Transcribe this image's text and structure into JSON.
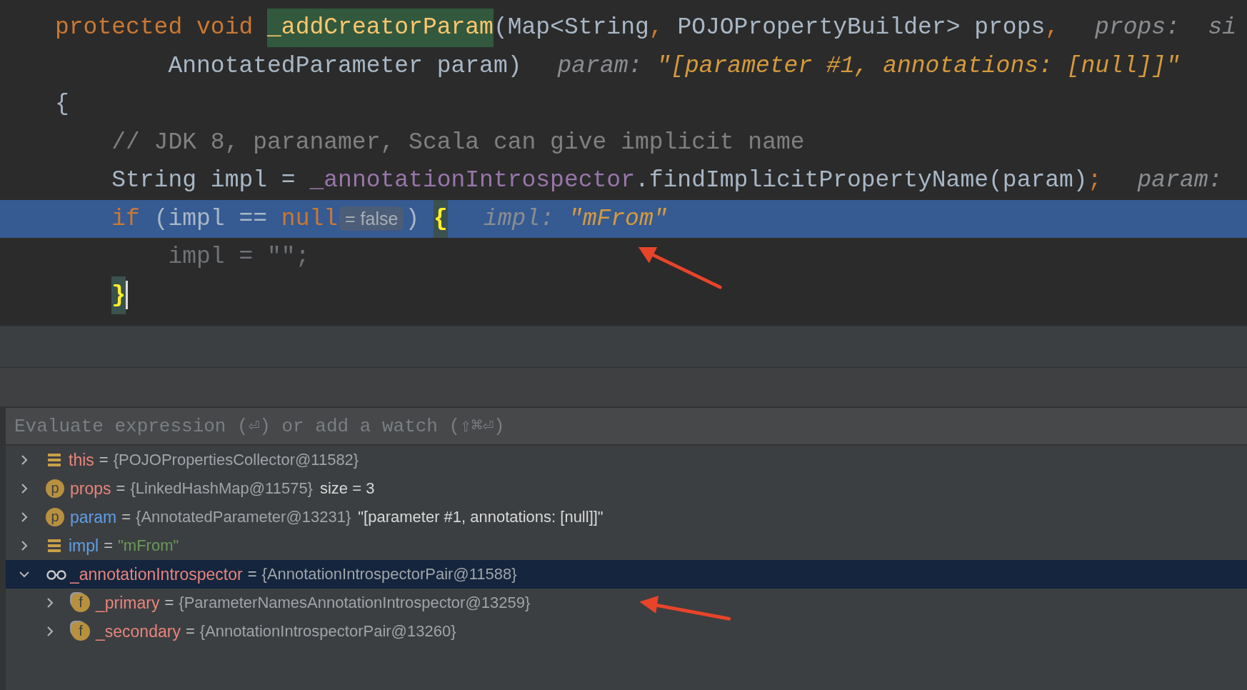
{
  "code": {
    "lines": [
      {
        "execution_point": false,
        "caret": false,
        "tokens": [
          {
            "kind": "keyword",
            "text": "protected void "
          },
          {
            "kind": "method-declaration",
            "text": "_addCreatorParam"
          },
          {
            "kind": "plain",
            "text": "(Map<String"
          },
          {
            "kind": "keyword",
            "text": ", "
          },
          {
            "kind": "plain",
            "text": "POJOPropertyBuilder> props"
          },
          {
            "kind": "keyword",
            "text": ","
          }
        ],
        "hint": {
          "label": "props:  si"
        }
      },
      {
        "execution_point": false,
        "caret": false,
        "tokens": [
          {
            "kind": "plain",
            "text": "        AnnotatedParameter param)"
          }
        ],
        "hint": {
          "label": "param:",
          "value": "\"[parameter #1, annotations: [null]]\""
        }
      },
      {
        "execution_point": false,
        "caret": false,
        "tokens": [
          {
            "kind": "plain",
            "text": "{"
          }
        ]
      },
      {
        "execution_point": false,
        "caret": false,
        "tokens": [
          {
            "kind": "comment",
            "text": "    // JDK 8, paranamer, Scala can give implicit name"
          }
        ]
      },
      {
        "execution_point": false,
        "caret": false,
        "tokens": [
          {
            "kind": "plain",
            "text": "    String impl = "
          },
          {
            "kind": "field",
            "text": "_annotationIntrospector"
          },
          {
            "kind": "plain",
            "text": ".findImplicitPropertyName(param)"
          },
          {
            "kind": "keyword",
            "text": ";"
          }
        ],
        "hint": {
          "label": "param:"
        }
      },
      {
        "execution_point": true,
        "caret": false,
        "tokens": [
          {
            "kind": "keyword",
            "text": "    if "
          },
          {
            "kind": "plain",
            "text": "(impl == "
          },
          {
            "kind": "keyword",
            "text": "null"
          },
          {
            "kind": "inline-value",
            "text": "= false"
          },
          {
            "kind": "plain",
            "text": ") "
          },
          {
            "kind": "brace-match",
            "text": "{"
          }
        ],
        "hint": {
          "label": "impl:",
          "value": "\"mFrom\""
        }
      },
      {
        "execution_point": false,
        "caret": false,
        "tokens": [
          {
            "kind": "dimmed",
            "text": "        impl = \"\";"
          }
        ]
      },
      {
        "execution_point": false,
        "caret": true,
        "indented": true,
        "tokens": [
          {
            "kind": "brace-match",
            "text": "}"
          }
        ]
      }
    ]
  },
  "debugger": {
    "evaluate": {
      "placeholder": "Evaluate expression (⏎) or add a watch (⇧⌘⏎)"
    },
    "variables": [
      {
        "kind": "local",
        "name": "this",
        "color": "#e8847d",
        "operator": "=",
        "value": "{POJOPropertiesCollector@11582}",
        "expanded": false,
        "selected": false
      },
      {
        "kind": "parameter",
        "icon_text": "p",
        "name": "props",
        "color": "#e8847d",
        "operator": "=",
        "value": "{LinkedHashMap@11575}",
        "extra": "size = 3",
        "expanded": false,
        "selected": false
      },
      {
        "kind": "parameter",
        "icon_text": "p",
        "name": "param",
        "color": "#5f9ee8",
        "operator": "=",
        "value": "{AnnotatedParameter@13231}",
        "extra": "\"[parameter #1, annotations: [null]]\"",
        "expanded": false,
        "selected": false
      },
      {
        "kind": "string-local",
        "name": "impl",
        "color": "#5f9ee8",
        "operator": "=",
        "value": "\"mFrom\"",
        "expanded": false,
        "selected": false
      },
      {
        "kind": "watch",
        "name": "_annotationIntrospector",
        "color": "#e8847d",
        "operator": "=",
        "value": "{AnnotationIntrospectorPair@11588}",
        "expanded": true,
        "selected": true,
        "children": [
          {
            "kind": "field",
            "icon_text": "f",
            "name": "_primary",
            "color": "#e8847d",
            "operator": "=",
            "value": "{ParameterNamesAnnotationIntrospector@13259}",
            "expanded": false,
            "selected": false
          },
          {
            "kind": "field",
            "icon_text": "f",
            "name": "_secondary",
            "color": "#e8847d",
            "operator": "=",
            "value": "{AnnotationIntrospectorPair@13260}",
            "expanded": false,
            "selected": false
          }
        ]
      }
    ]
  }
}
